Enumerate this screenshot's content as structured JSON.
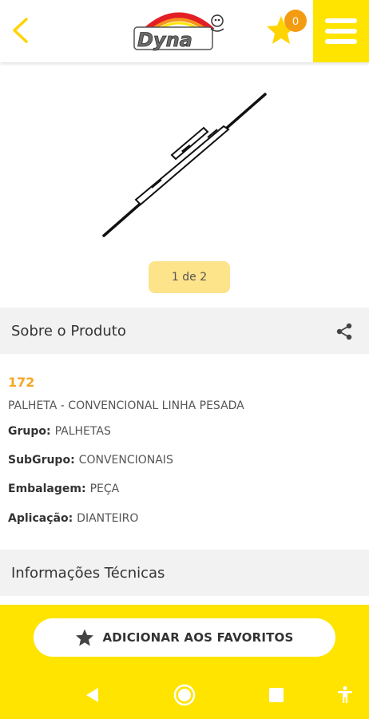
{
  "header": {
    "back_icon": "chevron-left-icon",
    "logo_text": "Dyna",
    "favorites_count": "0",
    "menu_icon": "hamburger-icon"
  },
  "gallery": {
    "pager": "1 de 2"
  },
  "about": {
    "title": "Sobre o Produto",
    "share_icon": "share-icon"
  },
  "product": {
    "code": "172",
    "description": "PALHETA - CONVENCIONAL LINHA PESADA",
    "group_label": "Grupo:",
    "group_value": "PALHETAS",
    "subgroup_label": "SubGrupo:",
    "subgroup_value": "CONVENCIONAIS",
    "packaging_label": "Embalagem:",
    "packaging_value": "PEÇA",
    "application_label": "Aplicação:",
    "application_value": "DIANTEIRO"
  },
  "tech": {
    "title": "Informações Técnicas"
  },
  "actions": {
    "add_favorite": "ADICIONAR AOS FAVORITOS"
  },
  "colors": {
    "accent": "#ffe400",
    "orange": "#f5a623",
    "pager_bg": "#fde38a"
  }
}
